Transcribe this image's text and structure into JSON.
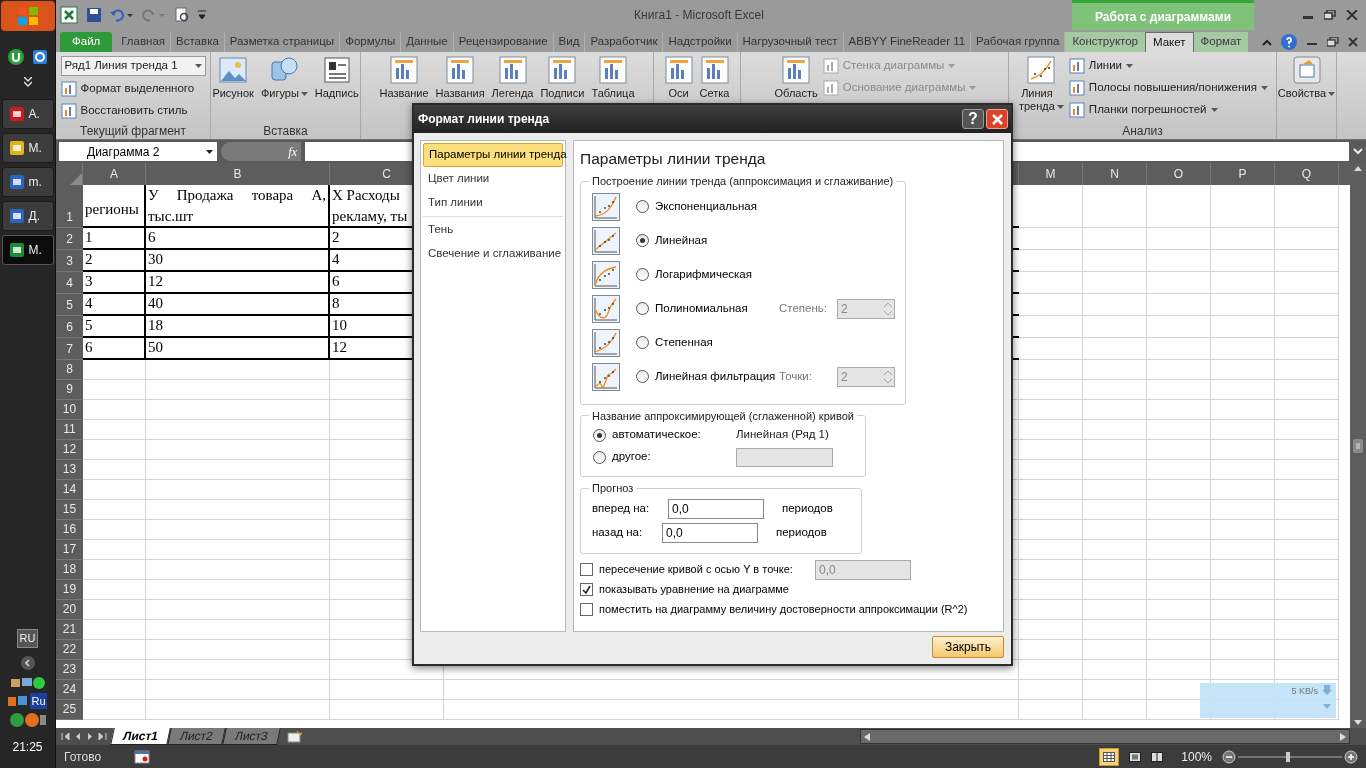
{
  "taskbar": {
    "buttons": [
      {
        "label": "А.",
        "selected": false
      },
      {
        "label": "М.",
        "selected": false
      },
      {
        "label": "m.",
        "selected": false
      },
      {
        "label": "Д.",
        "selected": false
      },
      {
        "label": "М.",
        "selected": true
      }
    ],
    "language": "RU",
    "tray_label": "Ru",
    "clock": "21:25"
  },
  "title_bar": {
    "title": "Книга1  -  Microsoft Excel",
    "context_group": "Работа с диаграммами"
  },
  "ribbon_tabs": [
    {
      "label": "Файл",
      "kind": "file",
      "selected": false
    },
    {
      "label": "Главная",
      "kind": "normal",
      "selected": false
    },
    {
      "label": "Вставка",
      "kind": "normal",
      "selected": false
    },
    {
      "label": "Разметка страницы",
      "kind": "normal",
      "selected": false
    },
    {
      "label": "Формулы",
      "kind": "normal",
      "selected": false
    },
    {
      "label": "Данные",
      "kind": "normal",
      "selected": false
    },
    {
      "label": "Рецензирование",
      "kind": "normal",
      "selected": false
    },
    {
      "label": "Вид",
      "kind": "normal",
      "selected": false
    },
    {
      "label": "Разработчик",
      "kind": "normal",
      "selected": false
    },
    {
      "label": "Надстройки",
      "kind": "normal",
      "selected": false
    },
    {
      "label": "Нагрузочный тест",
      "kind": "normal",
      "selected": false
    },
    {
      "label": "ABBYY FineReader 11",
      "kind": "normal",
      "selected": false
    },
    {
      "label": "Рабочая группа",
      "kind": "normal",
      "selected": false
    },
    {
      "label": "Конструктор",
      "kind": "context",
      "selected": false
    },
    {
      "label": "Макет",
      "kind": "context",
      "selected": true
    },
    {
      "label": "Формат",
      "kind": "context",
      "selected": false
    }
  ],
  "ribbon_groups": [
    {
      "label": "Текущий фрагмент",
      "items": [
        {
          "kind": "combo",
          "label": "Ряд1 Линия тренда 1",
          "dropdown": true,
          "disabled": false
        },
        {
          "kind": "small",
          "label": "Формат выделенного",
          "dropdown": false,
          "disabled": false
        },
        {
          "kind": "small",
          "label": "Восстановить стиль",
          "dropdown": false,
          "disabled": false
        }
      ]
    },
    {
      "label": "Вставка",
      "items": [
        {
          "kind": "large",
          "label": "Рисунок",
          "dropdown": false,
          "disabled": false
        },
        {
          "kind": "large",
          "label": "Фигуры",
          "dropdown": true,
          "disabled": false
        },
        {
          "kind": "large",
          "label": "Надпись",
          "dropdown": false,
          "disabled": false
        }
      ]
    },
    {
      "items": [
        {
          "kind": "large",
          "label": "Название",
          "dropdown": false,
          "disabled": false
        },
        {
          "kind": "large",
          "label": "Названия",
          "dropdown": false,
          "disabled": false
        },
        {
          "kind": "large",
          "label": "Легенда",
          "dropdown": false,
          "disabled": false
        },
        {
          "kind": "large",
          "label": "Подписи",
          "dropdown": false,
          "disabled": false
        },
        {
          "kind": "large",
          "label": "Таблица",
          "dropdown": false,
          "disabled": false
        }
      ]
    },
    {
      "items": [
        {
          "kind": "large",
          "label": "Оси",
          "dropdown": false,
          "disabled": false
        },
        {
          "kind": "large",
          "label": "Сетка",
          "dropdown": false,
          "disabled": false
        }
      ]
    },
    {
      "items": [
        {
          "kind": "large",
          "label": "Область",
          "dropdown": false,
          "disabled": false
        },
        {
          "kind": "small",
          "label": "Стенка диаграммы",
          "dropdown": true,
          "disabled": true
        },
        {
          "kind": "small",
          "label": "Основание диаграммы",
          "dropdown": true,
          "disabled": true
        }
      ]
    },
    {
      "label": "Анализ",
      "items": [
        {
          "kind": "large",
          "label": "Линия\nтренда",
          "dropdown": true,
          "disabled": false
        },
        {
          "kind": "small",
          "label": "Линии",
          "dropdown": true,
          "disabled": false
        },
        {
          "kind": "small",
          "label": "Полосы повышения/понижения",
          "dropdown": true,
          "disabled": false
        },
        {
          "kind": "small",
          "label": "Планки погрешностей",
          "dropdown": true,
          "disabled": false
        }
      ]
    },
    {
      "items": [
        {
          "kind": "large",
          "label": "Свойства",
          "dropdown": true,
          "disabled": false
        }
      ]
    }
  ],
  "formula_bar": {
    "name_box": "Диаграмма 2",
    "fx": "fx"
  },
  "sheet": {
    "columns_left": [
      "A",
      "B",
      "C"
    ],
    "columns_right": [
      "M",
      "N",
      "O",
      "P",
      "Q"
    ],
    "row_numbers": [
      "1",
      "2",
      "3",
      "4",
      "5",
      "6",
      "7",
      "8",
      "9",
      "10",
      "11",
      "12",
      "13",
      "14",
      "15",
      "16",
      "17",
      "18",
      "19",
      "20",
      "21",
      "22",
      "23",
      "24",
      "25"
    ],
    "rows": [
      [
        "регионы",
        "У Продажа товара А, тыс.шт",
        "X Расходы\nрекламу, ты"
      ],
      [
        "1",
        "6",
        "2"
      ],
      [
        "2",
        "30",
        "4"
      ],
      [
        "3",
        "12",
        "6"
      ],
      [
        "4",
        "40",
        "8"
      ],
      [
        "5",
        "18",
        "10"
      ],
      [
        "6",
        "50",
        "12"
      ]
    ]
  },
  "sheet_tabs": [
    {
      "label": "Лист1",
      "selected": true
    },
    {
      "label": "Лист2",
      "selected": false
    },
    {
      "label": "Лист3",
      "selected": false
    }
  ],
  "status_bar": {
    "status": "Готово",
    "zoom": "100%"
  },
  "network_meter": {
    "speed": "5 KB/s"
  },
  "dialog": {
    "title": "Формат линии тренда",
    "help": "?",
    "nav": [
      {
        "label": "Параметры линии тренда",
        "selected": true,
        "separator_after": false
      },
      {
        "label": "Цвет линии",
        "selected": false,
        "separator_after": false
      },
      {
        "label": "Тип линии",
        "selected": false,
        "separator_after": true
      },
      {
        "label": "Тень",
        "selected": false,
        "separator_after": false
      },
      {
        "label": "Свечение и сглаживание",
        "selected": false,
        "separator_after": false
      }
    ],
    "heading": "Параметры линии тренда",
    "trend_group": {
      "label": "Построение линии тренда (аппроксимация и сглаживание)",
      "options": [
        {
          "label": "Экспоненциальная",
          "selected": false
        },
        {
          "label": "Линейная",
          "selected": true
        },
        {
          "label": "Логарифмическая",
          "selected": false
        },
        {
          "label": "Полиномиальная",
          "selected": false,
          "param": {
            "label": "Степень:",
            "value": "2",
            "disabled": true
          }
        },
        {
          "label": "Степенная",
          "selected": false
        },
        {
          "label": "Линейная фильтрация",
          "selected": false,
          "param": {
            "label": "Точки:",
            "value": "2",
            "disabled": true
          }
        }
      ]
    },
    "name_group": {
      "label": "Название аппроксимирующей (сглаженной) кривой",
      "options": [
        {
          "label": "автоматическое:",
          "selected": true,
          "value": "Линейная (Ряд 1)"
        },
        {
          "label": "другое:",
          "selected": false,
          "field": true
        }
      ]
    },
    "forecast": {
      "label": "Прогноз",
      "rows": [
        {
          "label": "вперед на:",
          "value": "0,0",
          "unit": "периодов"
        },
        {
          "label": "назад на:",
          "value": "0,0",
          "unit": "периодов"
        }
      ]
    },
    "checkboxes": [
      {
        "label": "пересечение кривой с осью Y в точке:",
        "checked": false,
        "value": "0,0"
      },
      {
        "label": "показывать уравнение на диаграмме",
        "checked": true
      },
      {
        "label": "поместить на диаграмму величину достоверности аппроксимации (R^2)",
        "checked": false
      }
    ],
    "close_button": "Закрыть"
  }
}
